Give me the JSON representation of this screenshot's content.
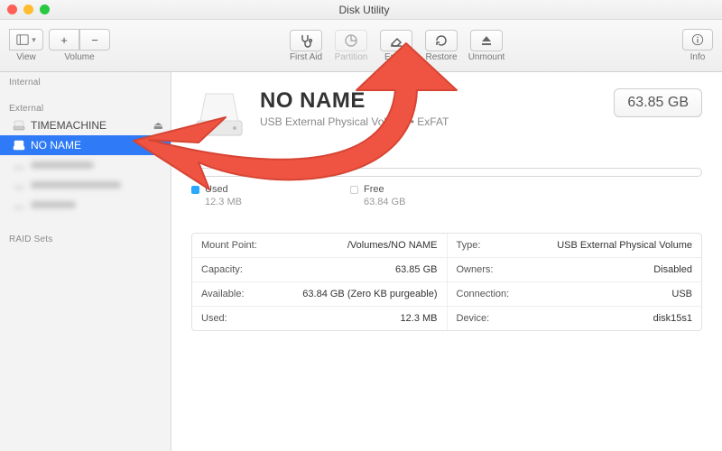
{
  "window": {
    "title": "Disk Utility"
  },
  "toolbar": {
    "view_label": "View",
    "volume_label": "Volume",
    "info_label": "Info",
    "tools": [
      {
        "id": "first-aid",
        "label": "First Aid",
        "enabled": true
      },
      {
        "id": "partition",
        "label": "Partition",
        "enabled": false
      },
      {
        "id": "erase",
        "label": "Erase",
        "enabled": true
      },
      {
        "id": "restore",
        "label": "Restore",
        "enabled": true
      },
      {
        "id": "unmount",
        "label": "Unmount",
        "enabled": true
      }
    ]
  },
  "sidebar": {
    "sections": [
      {
        "label": "Internal",
        "items": []
      },
      {
        "label": "External",
        "items": [
          {
            "name": "TIMEMACHINE",
            "selected": false,
            "ejectable": true
          },
          {
            "name": "NO NAME",
            "selected": true,
            "ejectable": true
          },
          {
            "name": "",
            "selected": false,
            "ejectable": false,
            "blurred": true
          },
          {
            "name": "",
            "selected": false,
            "ejectable": false,
            "blurred": true
          },
          {
            "name": "",
            "selected": false,
            "ejectable": false,
            "blurred": true
          }
        ]
      },
      {
        "label": "RAID Sets",
        "items": []
      }
    ]
  },
  "volume": {
    "name": "NO NAME",
    "subtitle": "USB External Physical Volume • ExFAT",
    "size_button": "63.85 GB",
    "usage": {
      "used": {
        "label": "Used",
        "value": "12.3 MB",
        "color": "#2aa7ff"
      },
      "free": {
        "label": "Free",
        "value": "63.84 GB"
      }
    },
    "info": [
      [
        {
          "k": "Mount Point:",
          "v": "/Volumes/NO NAME"
        },
        {
          "k": "Type:",
          "v": "USB External Physical Volume"
        }
      ],
      [
        {
          "k": "Capacity:",
          "v": "63.85 GB"
        },
        {
          "k": "Owners:",
          "v": "Disabled"
        }
      ],
      [
        {
          "k": "Available:",
          "v": "63.84 GB (Zero KB purgeable)"
        },
        {
          "k": "Connection:",
          "v": "USB"
        }
      ],
      [
        {
          "k": "Used:",
          "v": "12.3 MB"
        },
        {
          "k": "Device:",
          "v": "disk15s1"
        }
      ]
    ]
  },
  "annotation": {
    "color": "#ef5442"
  }
}
